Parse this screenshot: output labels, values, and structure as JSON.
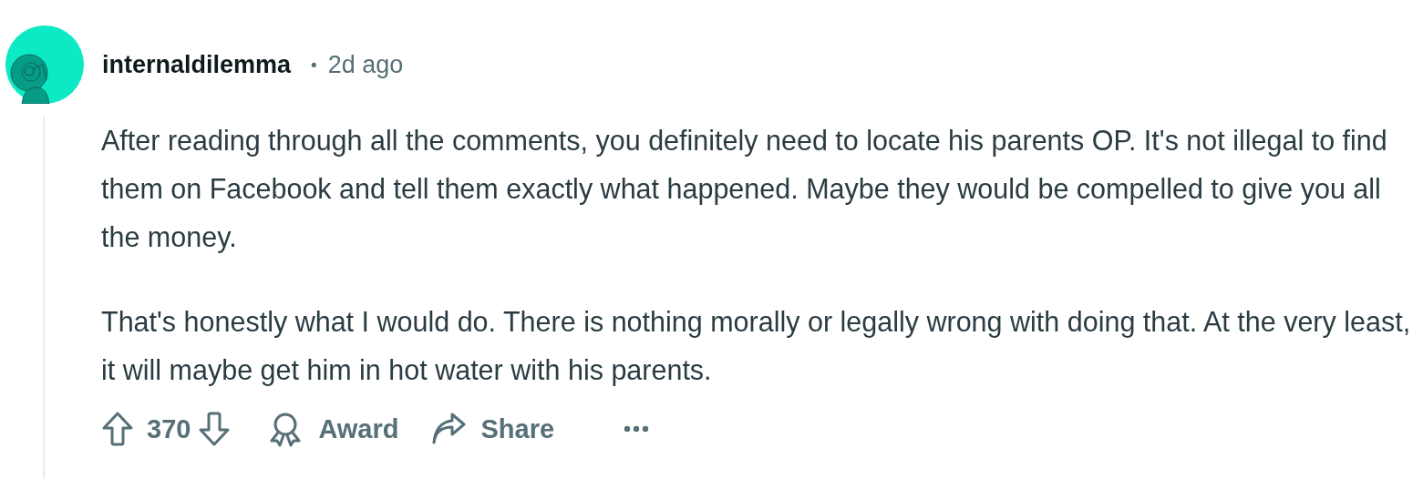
{
  "comment": {
    "author": "internaldilemma",
    "separator": "•",
    "time": "2d ago",
    "paragraphs": [
      "After reading through all the comments, you definitely need to locate his parents OP. It's not illegal to find them on Facebook and tell them exactly what happened. Maybe they would be compelled to give you all the money.",
      "That's honestly what I would do. There is nothing morally or legally wrong with doing that. At the very least, it will maybe get him in hot water with his parents."
    ],
    "score": "370",
    "actions": [
      {
        "kind": "award",
        "label": "Award"
      },
      {
        "kind": "share",
        "label": "Share"
      }
    ]
  }
}
